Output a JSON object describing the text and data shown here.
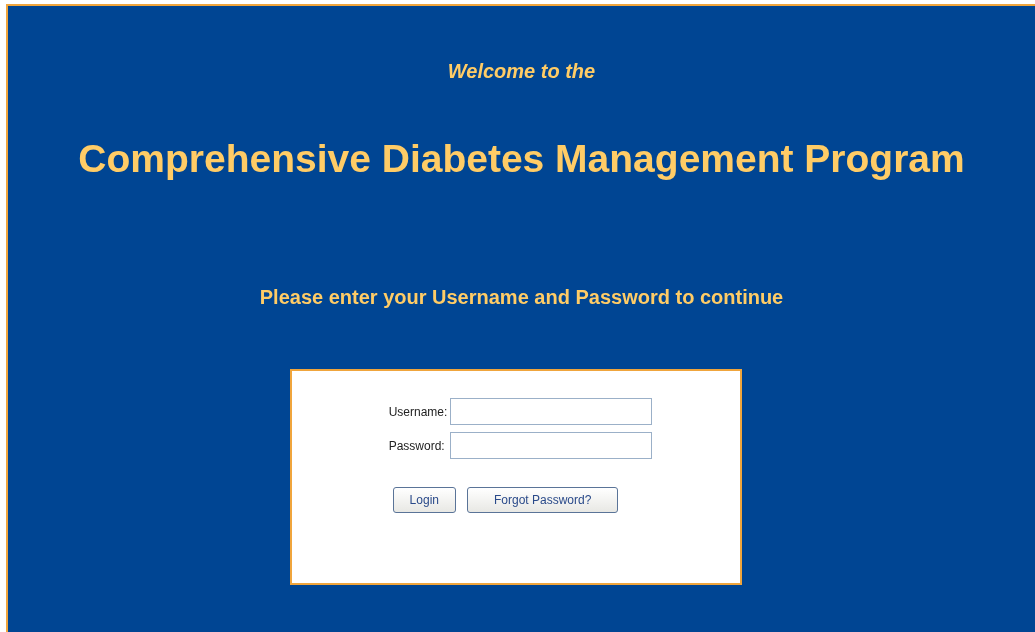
{
  "welcome": "Welcome to the",
  "title": "Comprehensive Diabetes Management Program",
  "prompt": "Please enter your Username and Password to continue",
  "fields": [
    {
      "label": "Username:"
    },
    {
      "label": "Password:"
    }
  ],
  "buttons": [
    {
      "label": "Login"
    },
    {
      "label": "Forgot Password?"
    }
  ]
}
